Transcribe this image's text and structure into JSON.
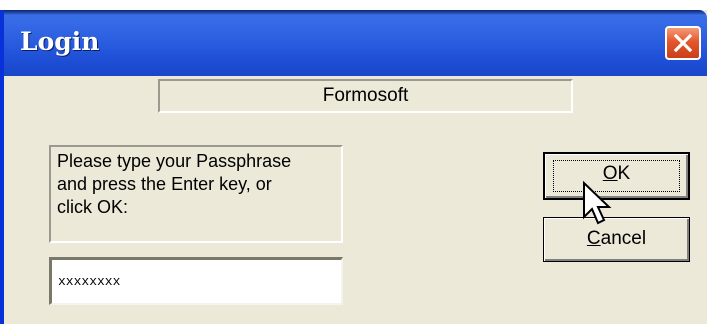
{
  "window": {
    "title": "Login",
    "close_icon": "close-icon"
  },
  "product": {
    "name": "Formosoft"
  },
  "prompt": {
    "line1": "Please type your Passphrase",
    "line2": "and press the Enter key, or",
    "line3": "click OK:"
  },
  "passphrase": {
    "value": "xxxxxxxx"
  },
  "buttons": {
    "ok_mnemonic": "O",
    "ok_rest": "K",
    "cancel_mnemonic": "C",
    "cancel_rest": "ancel"
  },
  "colors": {
    "titlebar": "#2b5fe0",
    "dialog_bg": "#ece9d8",
    "close_button": "#e3572b"
  },
  "icons": {
    "cursor": "arrow-cursor-icon"
  }
}
